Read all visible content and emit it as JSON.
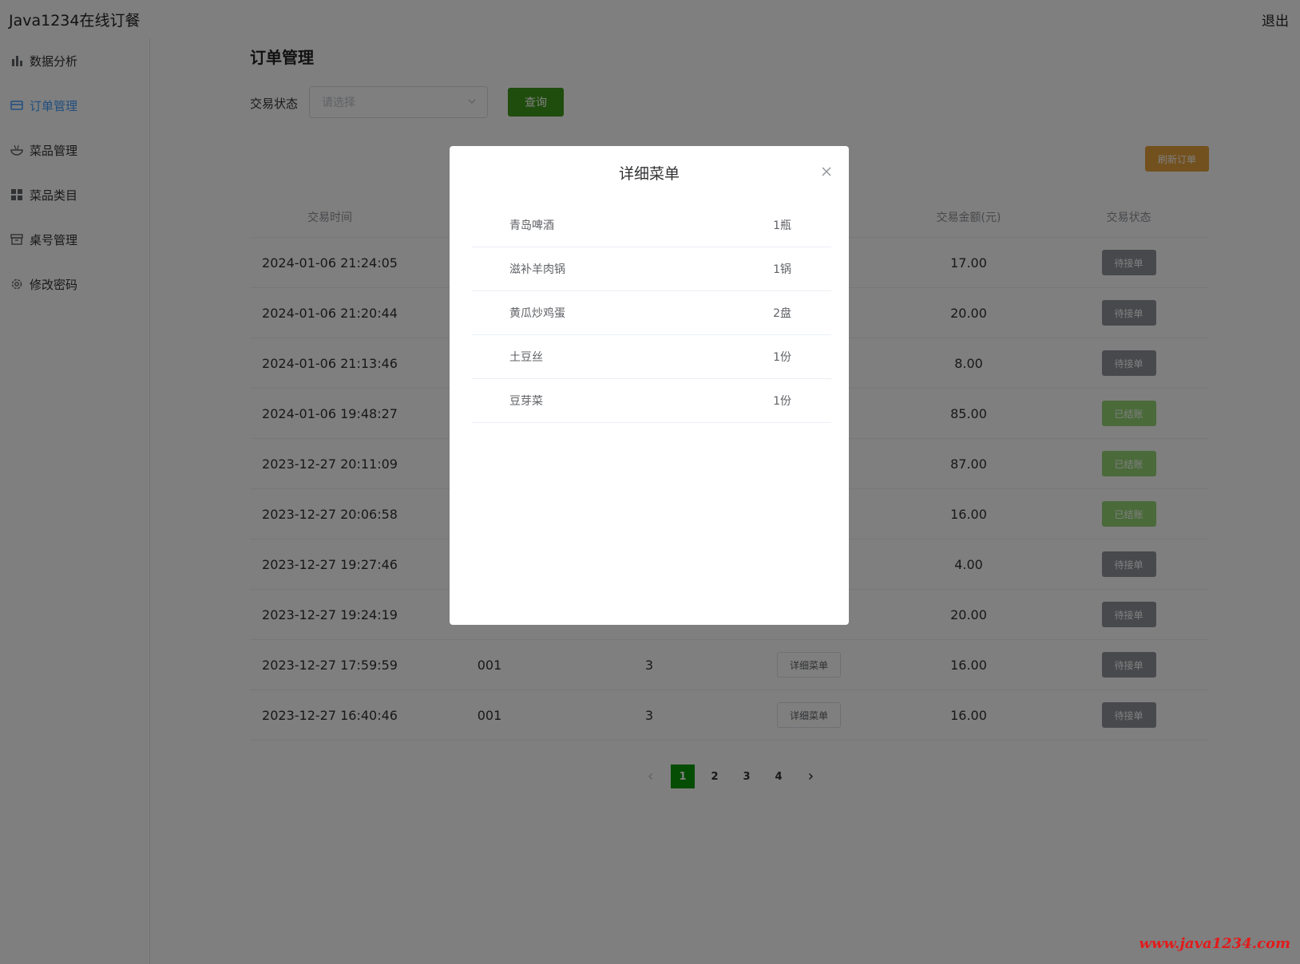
{
  "header": {
    "app_title": "Java1234在线订餐",
    "logout_label": "退出"
  },
  "sidebar": {
    "items": [
      {
        "label": "数据分析",
        "icon": "bar-chart-icon",
        "active": false
      },
      {
        "label": "订单管理",
        "icon": "card-icon",
        "active": true
      },
      {
        "label": "菜品管理",
        "icon": "bowl-icon",
        "active": false
      },
      {
        "label": "菜品类目",
        "icon": "grid-icon",
        "active": false
      },
      {
        "label": "桌号管理",
        "icon": "box-icon",
        "active": false
      },
      {
        "label": "修改密码",
        "icon": "gear-icon",
        "active": false
      }
    ],
    "active_color": "#409eff"
  },
  "main": {
    "title": "订单管理",
    "filter": {
      "label": "交易状态",
      "placeholder": "请选择",
      "query_label": "查询"
    },
    "refresh_label": "刷新订单",
    "table": {
      "headers": [
        "交易时间",
        "",
        "",
        "",
        "交易金额(元)",
        "交易状态"
      ],
      "rows": [
        {
          "time": "2024-01-06 21:24:05",
          "table_no": "",
          "people": "",
          "detail": "",
          "amount": "17.00",
          "status": "待接单"
        },
        {
          "time": "2024-01-06 21:20:44",
          "table_no": "",
          "people": "",
          "detail": "",
          "amount": "20.00",
          "status": "待接单"
        },
        {
          "time": "2024-01-06 21:13:46",
          "table_no": "",
          "people": "",
          "detail": "",
          "amount": "8.00",
          "status": "待接单"
        },
        {
          "time": "2024-01-06 19:48:27",
          "table_no": "",
          "people": "",
          "detail": "",
          "amount": "85.00",
          "status": "已结账"
        },
        {
          "time": "2023-12-27 20:11:09",
          "table_no": "",
          "people": "",
          "detail": "",
          "amount": "87.00",
          "status": "已结账"
        },
        {
          "time": "2023-12-27 20:06:58",
          "table_no": "",
          "people": "",
          "detail": "",
          "amount": "16.00",
          "status": "已结账"
        },
        {
          "time": "2023-12-27 19:27:46",
          "table_no": "",
          "people": "",
          "detail": "",
          "amount": "4.00",
          "status": "待接单"
        },
        {
          "time": "2023-12-27 19:24:19",
          "table_no": "",
          "people": "",
          "detail": "",
          "amount": "20.00",
          "status": "待接单"
        },
        {
          "time": "2023-12-27 17:59:59",
          "table_no": "001",
          "people": "3",
          "detail": "详细菜单",
          "amount": "16.00",
          "status": "待接单"
        },
        {
          "time": "2023-12-27 16:40:46",
          "table_no": "001",
          "people": "3",
          "detail": "详细菜单",
          "amount": "16.00",
          "status": "待接单"
        }
      ],
      "status_colors": {
        "待接单": "#909399",
        "已结账": "#95d475"
      }
    },
    "pagination": {
      "pages": [
        "1",
        "2",
        "3",
        "4"
      ],
      "current": "1",
      "prev_icon": "chevron-left-icon",
      "next_icon": "chevron-right-icon"
    }
  },
  "modal": {
    "title": "详细菜单",
    "close_icon": "close-icon",
    "items": [
      {
        "name": "青岛啤酒",
        "qty": "1瓶"
      },
      {
        "name": "滋补羊肉锅",
        "qty": "1锅"
      },
      {
        "name": "黄瓜炒鸡蛋",
        "qty": "2盘"
      },
      {
        "name": "土豆丝",
        "qty": "1份"
      },
      {
        "name": "豆芽菜",
        "qty": "1份"
      }
    ]
  },
  "watermark": "www.java1234.com",
  "colors": {
    "query_button": "#3f9b1a",
    "refresh_button": "#e6a23c",
    "pager_active": "#0a9a0a"
  }
}
